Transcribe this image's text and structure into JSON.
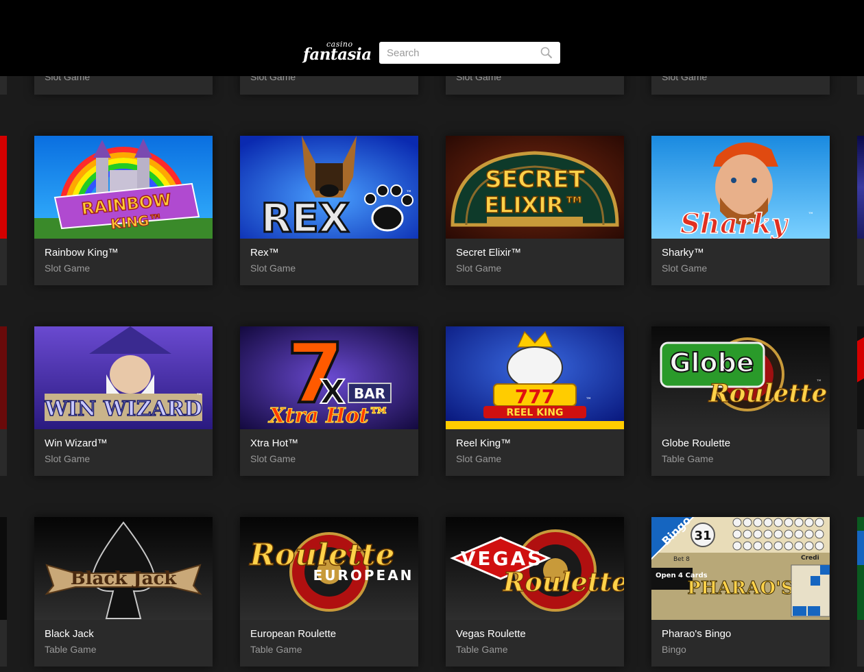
{
  "brand": {
    "small": "casino",
    "big": "fantasia"
  },
  "search": {
    "placeholder": "Search"
  },
  "top_row": {
    "type_label": "Slot Game"
  },
  "games": [
    {
      "name": "Rainbow King™",
      "type": "Slot Game",
      "art_text": [
        "RAINBOW",
        "KING™"
      ]
    },
    {
      "name": "Rex™",
      "type": "Slot Game",
      "art_text": [
        "REX",
        "™"
      ]
    },
    {
      "name": "Secret Elixir™",
      "type": "Slot Game",
      "art_text": [
        "SECRET",
        "ELIXIR™"
      ]
    },
    {
      "name": "Sharky™",
      "type": "Slot Game",
      "art_text": [
        "Sharky",
        "™"
      ]
    },
    {
      "name": "Win Wizard™",
      "type": "Slot Game",
      "art_text": [
        "WIN WIZARD",
        "™"
      ]
    },
    {
      "name": "Xtra Hot™",
      "type": "Slot Game",
      "art_text": [
        "7",
        "X",
        "BAR",
        "Xtra Hot™"
      ]
    },
    {
      "name": "Reel King™",
      "type": "Slot Game",
      "art_text": [
        "777",
        "REEL KING",
        "™"
      ]
    },
    {
      "name": "Globe Roulette",
      "type": "Table Game",
      "art_text": [
        "Globe",
        "Roulette",
        "™"
      ]
    },
    {
      "name": "Black Jack",
      "type": "Table Game",
      "art_text": [
        "Black Jack"
      ]
    },
    {
      "name": "European Roulette",
      "type": "Table Game",
      "art_text": [
        "Roulette",
        "EUROPEAN"
      ]
    },
    {
      "name": "Vegas Roulette",
      "type": "Table Game",
      "art_text": [
        "VEGAS",
        "Roulette"
      ]
    },
    {
      "name": "Pharao's Bingo",
      "type": "Bingo",
      "art_text": [
        "Bingo",
        "31",
        "Bet 8",
        "Open 4 Cards",
        "PHARAO'S",
        "Credi"
      ]
    }
  ],
  "colors": {
    "header_bg": "#000000",
    "page_bg": "#1b1b1b",
    "tile_bg": "#2a2a2a",
    "title_text": "#ffffff",
    "subtitle_text": "#9a9a9a"
  }
}
